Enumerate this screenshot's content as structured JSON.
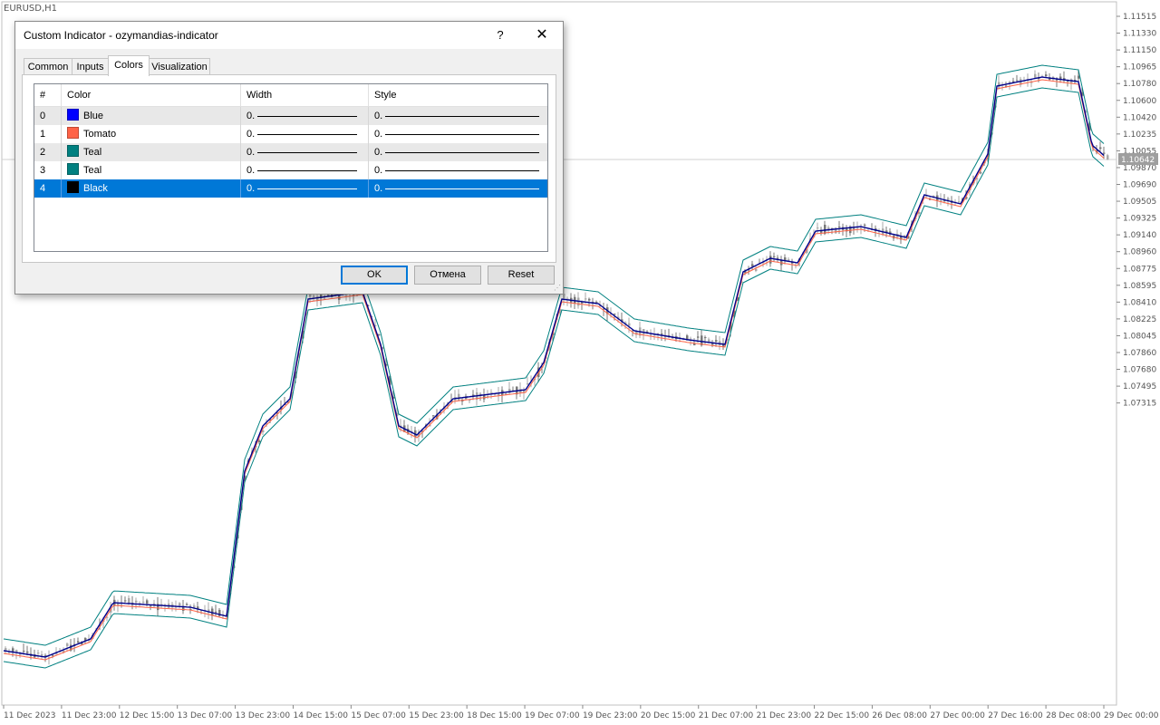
{
  "chart": {
    "symbol": "EURUSD,H1",
    "current_price": "1.10642",
    "price_labels": [
      "1.11515",
      "1.11330",
      "1.11150",
      "1.10965",
      "1.10780",
      "1.10600",
      "1.10420",
      "1.10235",
      "1.10055",
      "1.09870",
      "1.09690",
      "1.09505",
      "1.09325",
      "1.09140",
      "1.08960",
      "1.08775",
      "1.08595",
      "1.08410",
      "1.08225",
      "1.08045",
      "1.07860",
      "1.07680",
      "1.07495",
      "1.07315"
    ],
    "time_labels": [
      "11 Dec 2023",
      "11 Dec 23:00",
      "12 Dec 15:00",
      "13 Dec 07:00",
      "13 Dec 23:00",
      "14 Dec 15:00",
      "15 Dec 07:00",
      "15 Dec 23:00",
      "18 Dec 15:00",
      "19 Dec 07:00",
      "19 Dec 23:00",
      "20 Dec 15:00",
      "21 Dec 07:00",
      "21 Dec 23:00",
      "22 Dec 15:00",
      "26 Dec 08:00",
      "27 Dec 00:00",
      "27 Dec 16:00",
      "28 Dec 08:00",
      "29 Dec 00:00"
    ],
    "colors": {
      "candle": "#a8a8a8",
      "candle_dark": "#787878",
      "mid": "#00008b",
      "upper": "#008080",
      "lower": "#008080",
      "signal": "#ff6347",
      "grid": "#dcdcdc",
      "axis_text": "#555555"
    }
  },
  "dialog": {
    "title": "Custom Indicator - ozymandias-indicator",
    "help": "?",
    "close": "✕",
    "tabs": [
      {
        "label": "Common"
      },
      {
        "label": "Inputs"
      },
      {
        "label": "Colors"
      },
      {
        "label": "Visualization"
      }
    ],
    "active_tab": "Colors",
    "columns": [
      "#",
      "Color",
      "Width",
      "Style"
    ],
    "rows": [
      {
        "index": "0",
        "color_name": "Blue",
        "color": "#0000ff",
        "width": "0.",
        "style": "0."
      },
      {
        "index": "1",
        "color_name": "Tomato",
        "color": "#ff6347",
        "width": "0.",
        "style": "0."
      },
      {
        "index": "2",
        "color_name": "Teal",
        "color": "#008080",
        "width": "0.",
        "style": "0."
      },
      {
        "index": "3",
        "color_name": "Teal",
        "color": "#008080",
        "width": "0.",
        "style": "0."
      },
      {
        "index": "4",
        "color_name": "Black",
        "color": "#000000",
        "width": "0.",
        "style": "0."
      }
    ],
    "selected_row": 4,
    "buttons": {
      "ok": "OK",
      "cancel": "Отмена",
      "reset": "Reset"
    }
  }
}
